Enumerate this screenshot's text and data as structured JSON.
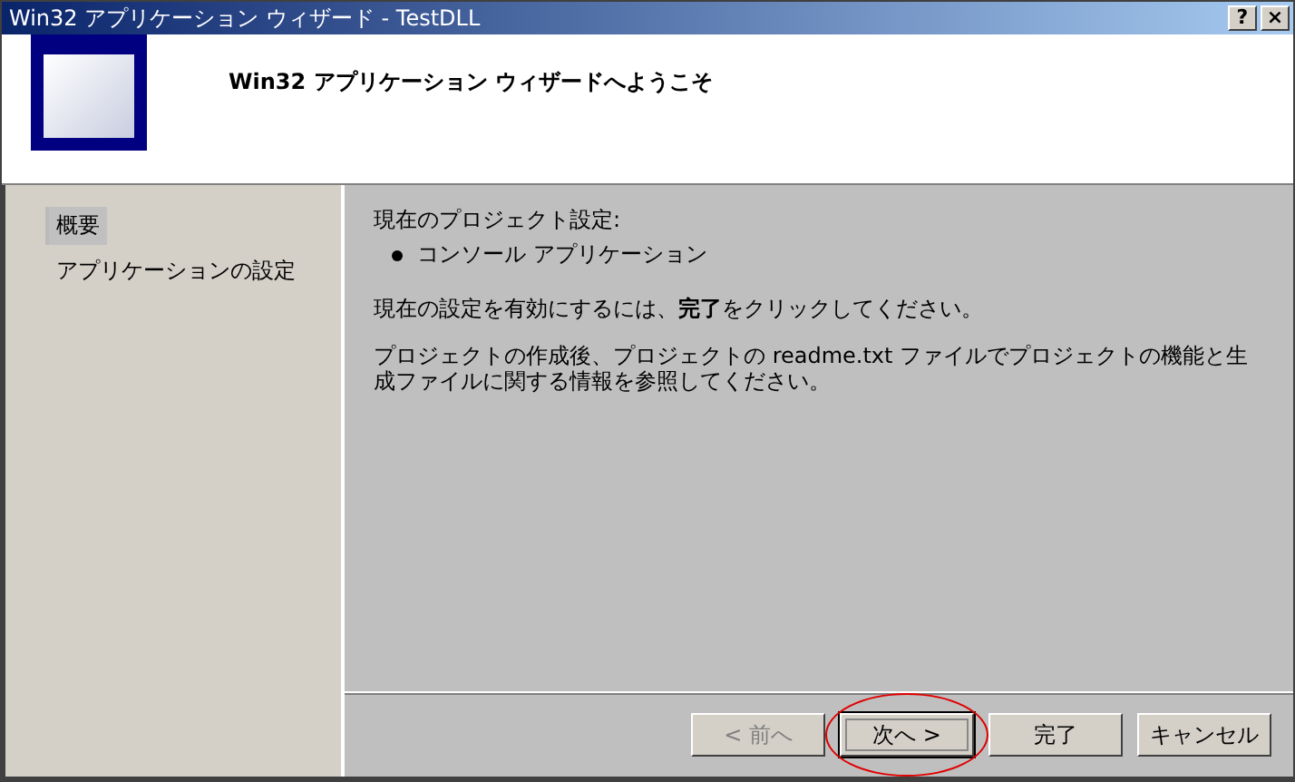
{
  "window": {
    "title": "Win32 アプリケーション ウィザード - TestDLL",
    "controls": [
      "?",
      "×"
    ]
  },
  "header": {
    "title": "Win32 アプリケーション ウィザードへようこそ"
  },
  "sidebar": {
    "items": [
      {
        "label": "概要",
        "selected": true
      },
      {
        "label": "アプリケーションの設定",
        "selected": false
      }
    ]
  },
  "content": {
    "heading": "現在のプロジェクト設定:",
    "bullets": [
      "コンソール アプリケーション"
    ],
    "paragraphs": [
      "現在の設定を有効にするには、**完了**をクリックしてください。",
      "プロジェクトの作成後、プロジェクトの readme.txt ファイルでプロジェクトの機能と生成ファイルに関する情報を参照してください。"
    ]
  },
  "buttons": [
    {
      "label": "< 前へ",
      "disabled": true,
      "default": false,
      "circled": false
    },
    {
      "label": "次へ >",
      "disabled": false,
      "default": true,
      "circled": true
    },
    {
      "label": "完了",
      "disabled": false,
      "default": false,
      "circled": false
    },
    {
      "label": "キャンセル",
      "disabled": false,
      "default": false,
      "circled": false
    }
  ]
}
